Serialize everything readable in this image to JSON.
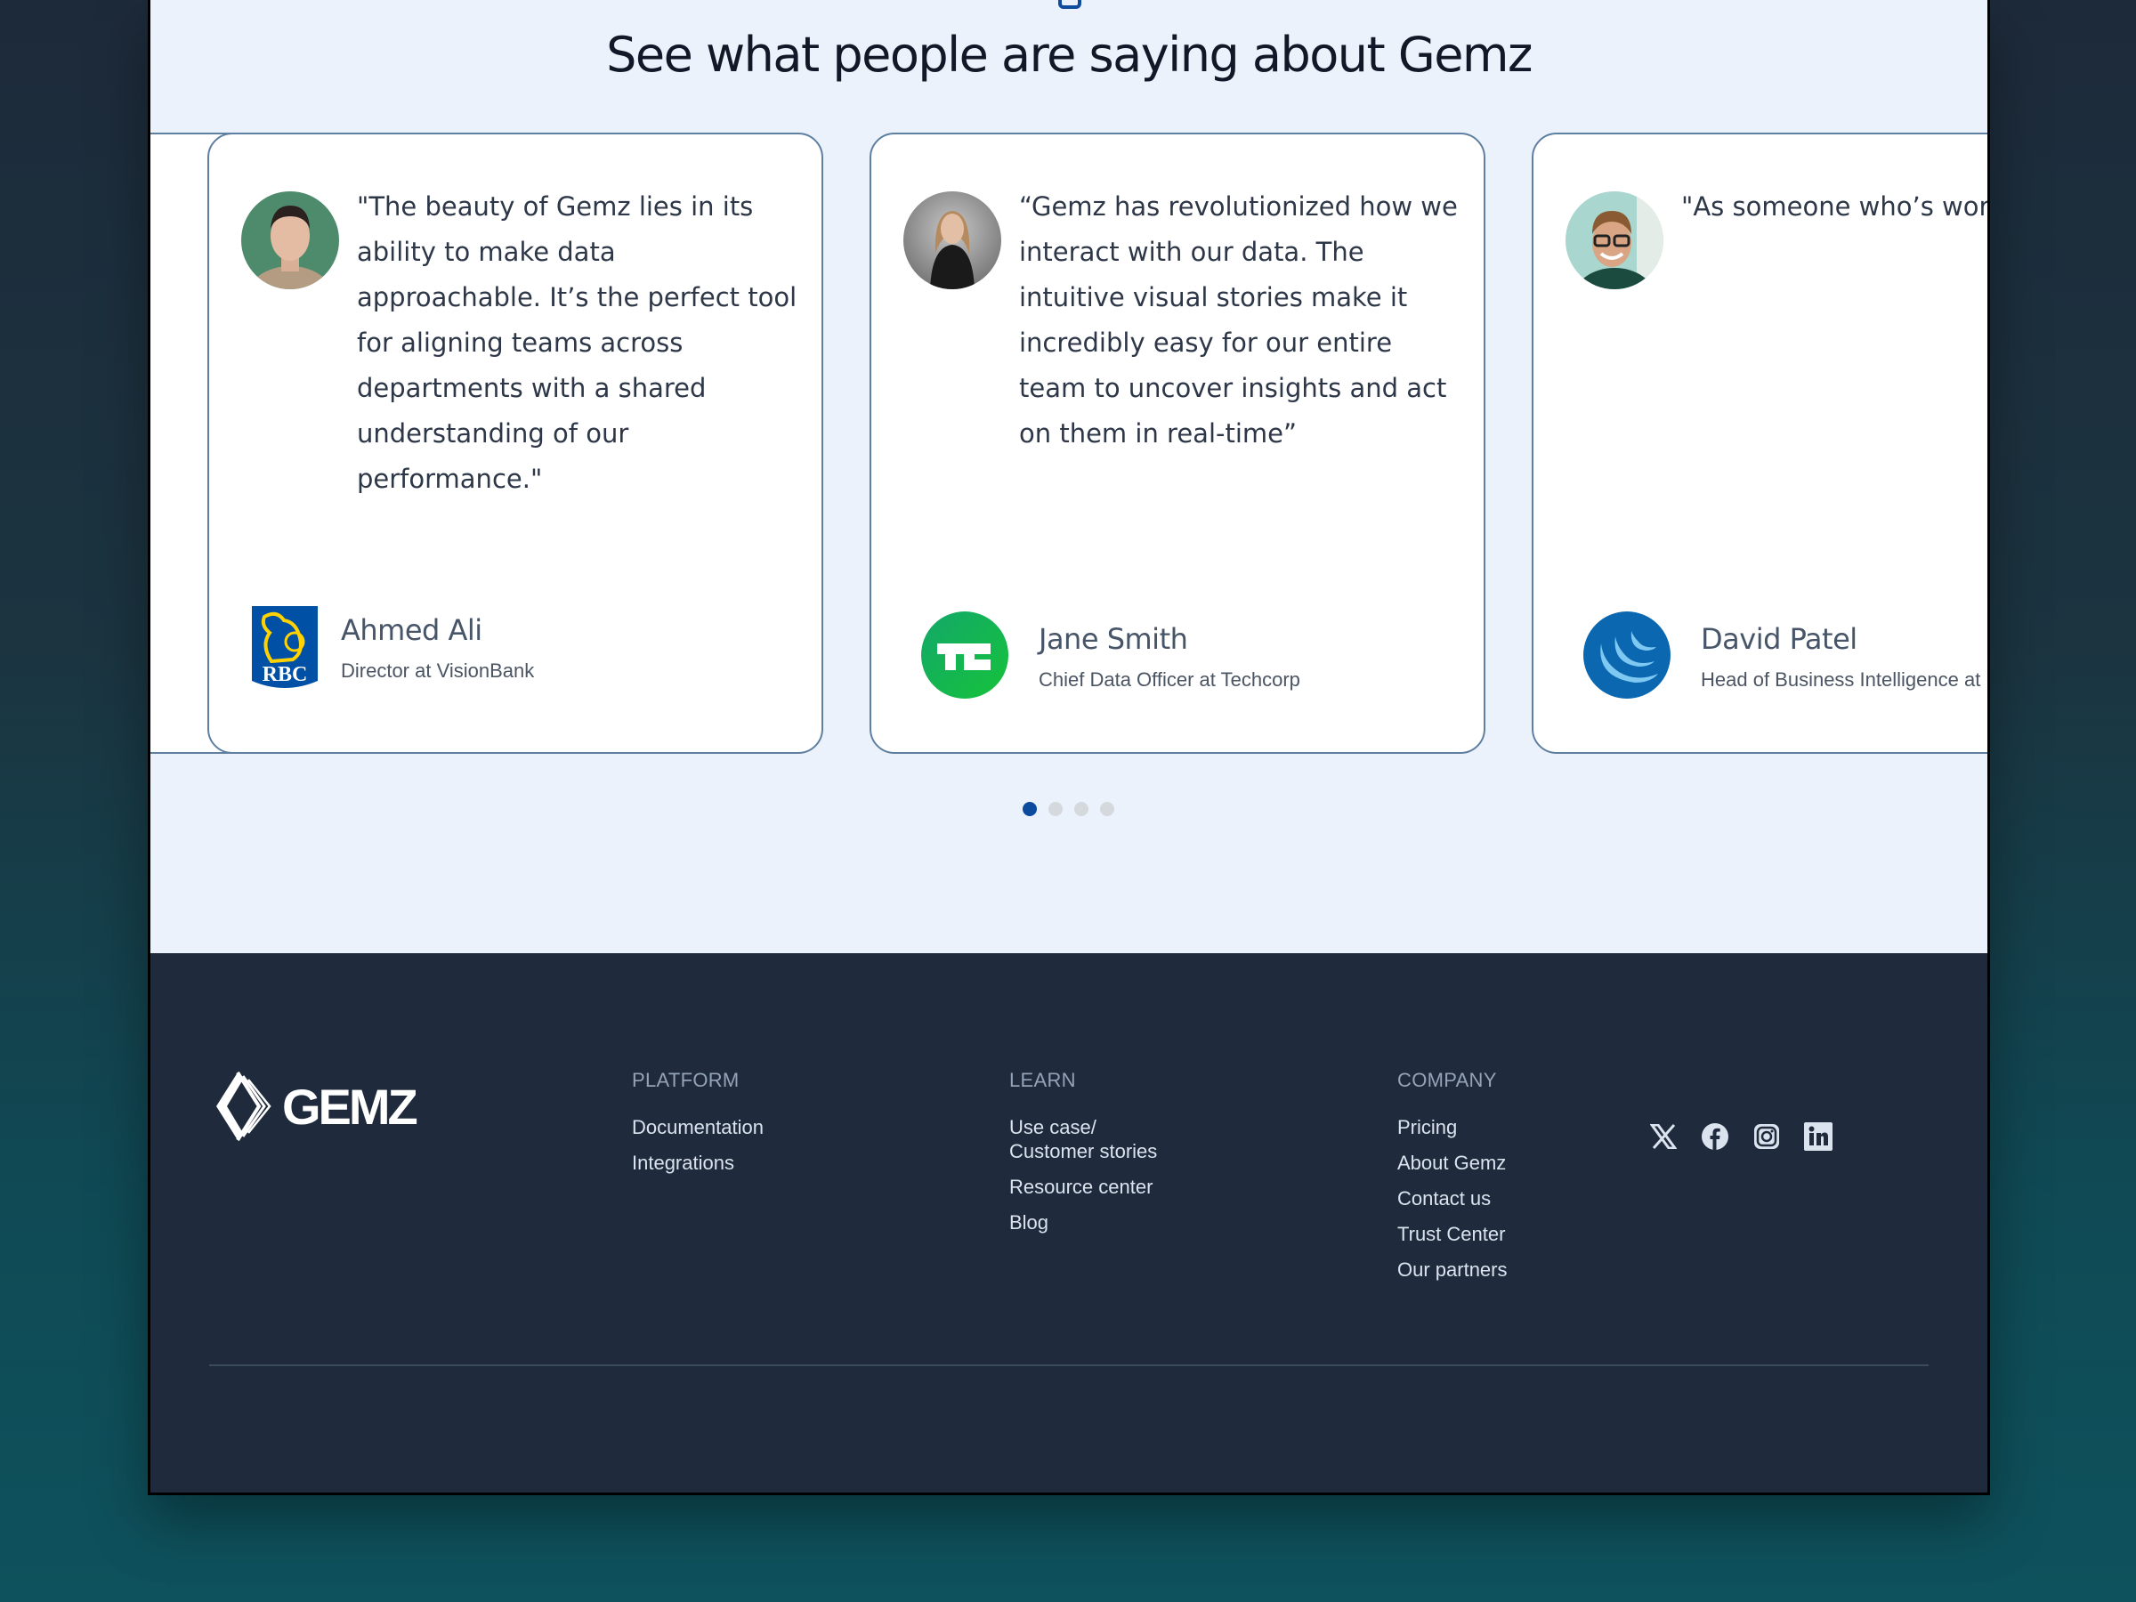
{
  "section": {
    "title": "See what people are saying about Gemz"
  },
  "testimonials": [
    {
      "quote": "\"The beauty of Gemz lies in its\nability to make data\napproachable. It’s the perfect tool\nfor aligning teams across\ndepartments with a shared\nunderstanding of our\nperformance.\"",
      "name": "Ahmed Ali",
      "title": "Director at VisionBank",
      "company_logo": "rbc-logo",
      "logo_text": "RBC"
    },
    {
      "quote": "“Gemz has revolutionized how we\ninteract with our data. The\nintuitive visual stories make it\nincredibly easy for our entire\nteam to uncover insights and act\non them in real-time”",
      "name": "Jane Smith",
      "title": "Chief Data Officer at Techcorp",
      "company_logo": "techcrunch-logo",
      "logo_text": "TC"
    },
    {
      "quote": "\"As someone who’s work\ncountless BI tools, I can\nconfidently say Gemz st\nfor its simplicity and\neffectiveness in transfor\ndata into actionable nar",
      "name": "David Patel",
      "title": "Head of Business Intelligence at",
      "company_logo": "wave-logo"
    }
  ],
  "pagination": {
    "total": 4,
    "active_index": 0
  },
  "footer": {
    "brand": "GEMZ",
    "columns": [
      {
        "title": "PLATFORM",
        "links": [
          "Documentation",
          "Integrations"
        ]
      },
      {
        "title": "LEARN",
        "links": [
          "Use case/\nCustomer stories",
          "Resource center",
          "Blog"
        ]
      },
      {
        "title": "COMPANY",
        "links": [
          "Pricing",
          "About Gemz",
          "Contact us",
          "Trust Center",
          "Our partners"
        ]
      }
    ],
    "socials": [
      "x-icon",
      "facebook-icon",
      "instagram-icon",
      "linkedin-icon"
    ]
  },
  "colors": {
    "section_bg": "#EBF2FB",
    "footer_bg": "#1F2A3C",
    "accent": "#0B4A9C",
    "techcrunch_green": "#15B84A",
    "rbc_blue": "#0051A5",
    "rbc_gold": "#FFD200"
  }
}
